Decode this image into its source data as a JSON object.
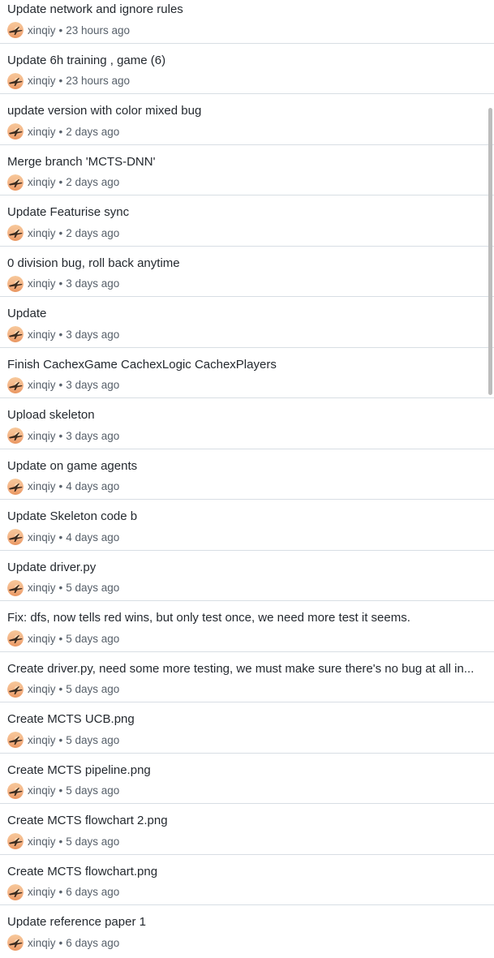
{
  "commits": [
    {
      "title": "Update network and ignore rules",
      "author": "xinqiy",
      "time": "23 hours ago"
    },
    {
      "title": "Update 6h training , game (6)",
      "author": "xinqiy",
      "time": "23 hours ago"
    },
    {
      "title": "update version with color mixed bug",
      "author": "xinqiy",
      "time": "2 days ago"
    },
    {
      "title": "Merge branch 'MCTS-DNN'",
      "author": "xinqiy",
      "time": "2 days ago"
    },
    {
      "title": "Update Featurise sync",
      "author": "xinqiy",
      "time": "2 days ago"
    },
    {
      "title": "0 division bug, roll back anytime",
      "author": "xinqiy",
      "time": "3 days ago"
    },
    {
      "title": "Update",
      "author": "xinqiy",
      "time": "3 days ago"
    },
    {
      "title": "Finish CachexGame CachexLogic CachexPlayers",
      "author": "xinqiy",
      "time": "3 days ago"
    },
    {
      "title": "Upload skeleton",
      "author": "xinqiy",
      "time": "3 days ago"
    },
    {
      "title": "Update on game agents",
      "author": "xinqiy",
      "time": "4 days ago"
    },
    {
      "title": "Update Skeleton code b",
      "author": "xinqiy",
      "time": "4 days ago"
    },
    {
      "title": "Update driver.py",
      "author": "xinqiy",
      "time": "5 days ago"
    },
    {
      "title": "Fix: dfs, now tells red wins, but only test once, we need more test it seems.",
      "author": "xinqiy",
      "time": "5 days ago"
    },
    {
      "title": "Create driver.py, need some more testing, we must make sure there's no bug at all in...",
      "author": "xinqiy",
      "time": "5 days ago"
    },
    {
      "title": "Create MCTS UCB.png",
      "author": "xinqiy",
      "time": "5 days ago"
    },
    {
      "title": "Create MCTS pipeline.png",
      "author": "xinqiy",
      "time": "5 days ago"
    },
    {
      "title": "Create MCTS flowchart 2.png",
      "author": "xinqiy",
      "time": "5 days ago"
    },
    {
      "title": "Create MCTS flowchart.png",
      "author": "xinqiy",
      "time": "6 days ago"
    },
    {
      "title": "Update reference paper 1",
      "author": "xinqiy",
      "time": "6 days ago"
    }
  ],
  "separator": "•",
  "avatar_icon": "sunset-airplane-avatar",
  "colors": {
    "title": "#24292f",
    "meta": "#57606a",
    "divider": "#d8dee4",
    "avatar_sky": "#f4b183",
    "avatar_silhouette": "#3a2a1e"
  }
}
